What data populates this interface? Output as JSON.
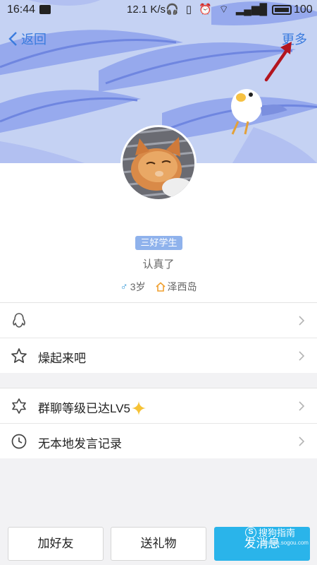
{
  "status_bar": {
    "time": "16:44",
    "network_speed": "12.1 K/s",
    "battery_level": "100"
  },
  "nav": {
    "back_label": "返回",
    "more_label": "更多"
  },
  "profile": {
    "badge": "三好学生",
    "signature": "认真了",
    "age": "3岁",
    "location": "泽西岛",
    "male_icon": "male-icon",
    "home_icon": "home-icon"
  },
  "list_group_1": [
    {
      "icon": "penguin-icon",
      "label": ""
    },
    {
      "icon": "star-icon",
      "label": "燥起来吧"
    }
  ],
  "list_group_2": [
    {
      "icon": "six-point-star-icon",
      "label": "群聊等级已达LV5"
    },
    {
      "icon": "clock-icon",
      "label": "无本地发言记录"
    }
  ],
  "bottom_buttons": {
    "add_friend": "加好友",
    "send_gift": "送礼物",
    "send_message": "发消息"
  },
  "watermark": {
    "logo": "S",
    "text": "搜狗指南",
    "url": "zhinan.sogou.com"
  },
  "colors": {
    "accent": "#3a7bde",
    "header_bg": "#c5d2f3",
    "badge_bg": "#8fb2ec",
    "send_button": "#2ab4ea",
    "arrow": "#b3151f"
  }
}
